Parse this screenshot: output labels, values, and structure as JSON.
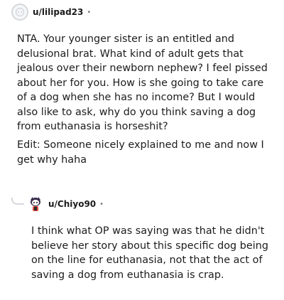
{
  "comments": [
    {
      "username": "u/lilipad23",
      "avatar_icon": "default-snoo-avatar-icon",
      "separator": "•",
      "paragraphs": [
        "NTA. Your younger sister is an entitled and delusional brat. What kind of adult gets that jealous over their newborn nephew? I feel pissed about her for you. How is she going to take care of a dog when she has no income? But I would also like to ask, why do you think saving a dog from euthanasia is horseshit?",
        "Edit: Someone nicely explained to me and now I get why haha"
      ]
    },
    {
      "username": "u/Chiyo90",
      "avatar_icon": "custom-snoo-avatar-icon",
      "separator": "•",
      "paragraphs": [
        "I think what OP was saying was that he didn't believe her story about this specific dog being on the line for euthanasia, not that the act of saving a dog from euthanasia is crap."
      ]
    }
  ]
}
